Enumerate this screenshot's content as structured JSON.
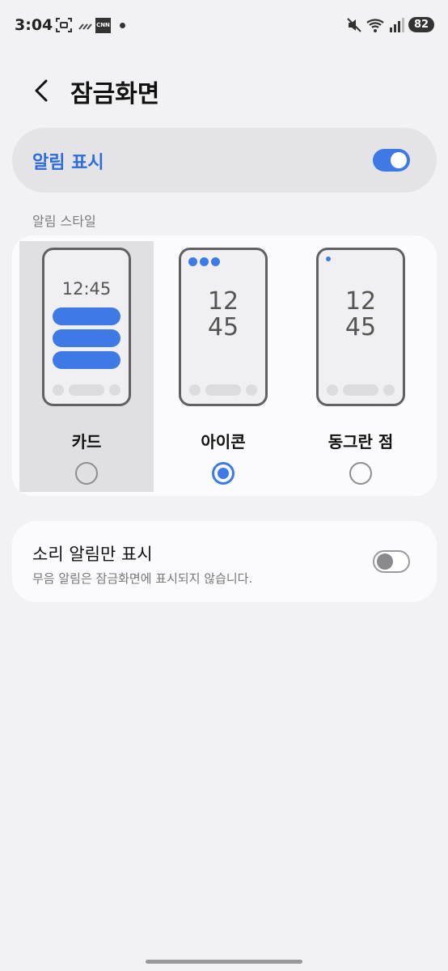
{
  "status_bar": {
    "time": "3:04",
    "battery": "82",
    "icons": [
      "screenshot-icon",
      "signal-strength-icon",
      "cnn-app-icon",
      "dot-icon",
      "mute-icon",
      "wifi-icon",
      "cellular-icon"
    ],
    "cnn_text": "CNN"
  },
  "header": {
    "title": "잠금화면"
  },
  "notifications": {
    "label": "알림 표시",
    "enabled": true
  },
  "style_section": {
    "label": "알림 스타일",
    "options": [
      {
        "label": "카드",
        "clock": "12:45",
        "selected": false,
        "highlighted": true
      },
      {
        "label": "아이콘",
        "clock_h": "12",
        "clock_m": "45",
        "selected": true,
        "highlighted": false
      },
      {
        "label": "동그란 점",
        "clock_h": "12",
        "clock_m": "45",
        "selected": false,
        "highlighted": false
      }
    ]
  },
  "sound_only": {
    "title": "소리 알림만 표시",
    "subtitle": "무음 알림은 잠금화면에 표시되지 않습니다.",
    "enabled": false
  },
  "colors": {
    "accent": "#3d7ae6",
    "background": "#f2f2f4"
  }
}
